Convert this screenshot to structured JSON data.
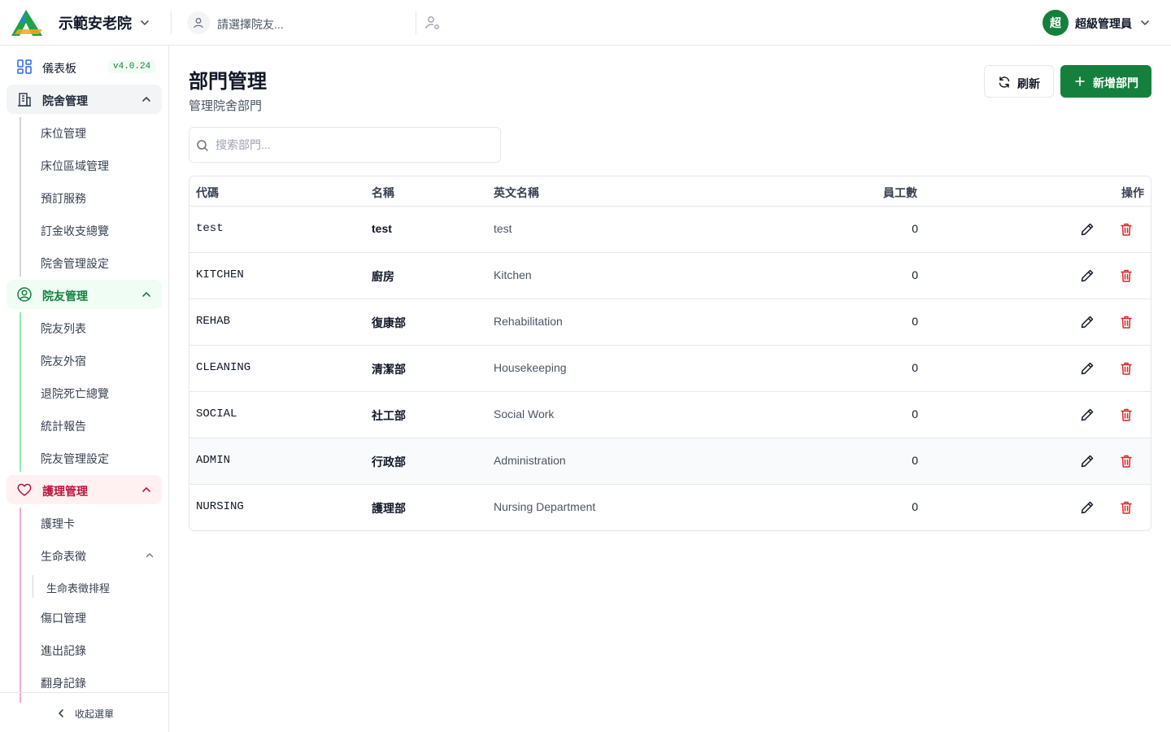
{
  "header": {
    "org_name": "示範安老院",
    "resident_placeholder": "請選擇院友...",
    "user_initial": "超",
    "user_name": "超級管理員"
  },
  "sidebar": {
    "dashboard": {
      "label": "儀表板",
      "version": "v4.0.24"
    },
    "groups": [
      {
        "label": "院舍管理",
        "color": "#1f2937",
        "items": [
          "床位管理",
          "床位區域管理",
          "預訂服務",
          "訂金收支總覽",
          "院舍管理設定"
        ]
      },
      {
        "label": "院友管理",
        "color": "#15803d",
        "items": [
          "院友列表",
          "院友外宿",
          "退院死亡總覽",
          "統計報告",
          "院友管理設定"
        ]
      },
      {
        "label": "護理管理",
        "color": "#be123c",
        "items": [
          "護理卡",
          "生命表徵",
          "生命表徵排程",
          "傷口管理",
          "進出記錄",
          "翻身記錄"
        ]
      }
    ],
    "collapse_label": "收起選單"
  },
  "page": {
    "title": "部門管理",
    "subtitle": "管理院舍部門",
    "refresh_label": "刷新",
    "add_label": "新增部門",
    "search_placeholder": "搜索部門..."
  },
  "table": {
    "columns": [
      "代碼",
      "名稱",
      "英文名稱",
      "員工數",
      "操作"
    ],
    "rows": [
      {
        "code": "test",
        "name": "test",
        "name_en": "test",
        "staff": "0"
      },
      {
        "code": "KITCHEN",
        "name": "廚房",
        "name_en": "Kitchen",
        "staff": "0"
      },
      {
        "code": "REHAB",
        "name": "復康部",
        "name_en": "Rehabilitation",
        "staff": "0"
      },
      {
        "code": "CLEANING",
        "name": "清潔部",
        "name_en": "Housekeeping",
        "staff": "0"
      },
      {
        "code": "SOCIAL",
        "name": "社工部",
        "name_en": "Social Work",
        "staff": "0"
      },
      {
        "code": "ADMIN",
        "name": "行政部",
        "name_en": "Administration",
        "staff": "0"
      },
      {
        "code": "NURSING",
        "name": "護理部",
        "name_en": "Nursing Department",
        "staff": "0"
      }
    ]
  },
  "colors": {
    "primary": "#15803d",
    "danger": "#dc2626",
    "nursing": "#be123c"
  }
}
